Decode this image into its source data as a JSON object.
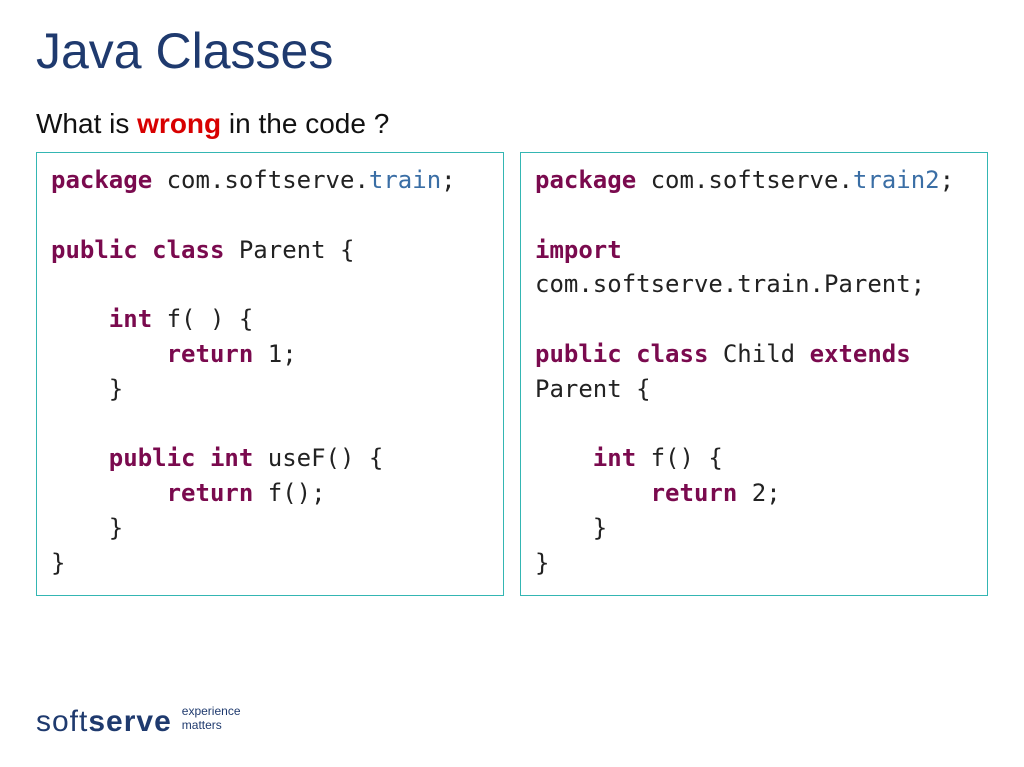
{
  "title": "Java Classes",
  "question": {
    "prefix": "What is ",
    "emph": "wrong",
    "suffix": " in the code ?"
  },
  "code_left": {
    "tokens": [
      {
        "c": "kw",
        "t": "package"
      },
      {
        "c": "plain",
        "t": " com.softserve."
      },
      {
        "c": "pk",
        "t": "train"
      },
      {
        "c": "plain",
        "t": ";"
      },
      {
        "c": "nl"
      },
      {
        "c": "nl"
      },
      {
        "c": "kw",
        "t": "public"
      },
      {
        "c": "plain",
        "t": " "
      },
      {
        "c": "kw",
        "t": "class"
      },
      {
        "c": "plain",
        "t": " Parent {"
      },
      {
        "c": "nl"
      },
      {
        "c": "nl"
      },
      {
        "c": "plain",
        "t": "    "
      },
      {
        "c": "kw",
        "t": "int"
      },
      {
        "c": "plain",
        "t": " f( ) {"
      },
      {
        "c": "nl"
      },
      {
        "c": "plain",
        "t": "        "
      },
      {
        "c": "kw",
        "t": "return"
      },
      {
        "c": "plain",
        "t": " 1;"
      },
      {
        "c": "nl"
      },
      {
        "c": "plain",
        "t": "    }"
      },
      {
        "c": "nl"
      },
      {
        "c": "nl"
      },
      {
        "c": "plain",
        "t": "    "
      },
      {
        "c": "kw",
        "t": "public"
      },
      {
        "c": "plain",
        "t": " "
      },
      {
        "c": "kw",
        "t": "int"
      },
      {
        "c": "plain",
        "t": " useF() {"
      },
      {
        "c": "nl"
      },
      {
        "c": "plain",
        "t": "        "
      },
      {
        "c": "kw",
        "t": "return"
      },
      {
        "c": "plain",
        "t": " f();"
      },
      {
        "c": "nl"
      },
      {
        "c": "plain",
        "t": "    }"
      },
      {
        "c": "nl"
      },
      {
        "c": "plain",
        "t": "}"
      }
    ]
  },
  "code_right": {
    "tokens": [
      {
        "c": "kw",
        "t": "package"
      },
      {
        "c": "plain",
        "t": " com.softserve."
      },
      {
        "c": "pk",
        "t": "train2"
      },
      {
        "c": "plain",
        "t": ";"
      },
      {
        "c": "nl"
      },
      {
        "c": "nl"
      },
      {
        "c": "kw",
        "t": "import"
      },
      {
        "c": "nl"
      },
      {
        "c": "plain",
        "t": "com.softserve.train.Parent;"
      },
      {
        "c": "nl"
      },
      {
        "c": "nl"
      },
      {
        "c": "kw",
        "t": "public"
      },
      {
        "c": "plain",
        "t": " "
      },
      {
        "c": "kw",
        "t": "class"
      },
      {
        "c": "plain",
        "t": " Child "
      },
      {
        "c": "kw",
        "t": "extends"
      },
      {
        "c": "nl"
      },
      {
        "c": "plain",
        "t": "Parent {"
      },
      {
        "c": "nl"
      },
      {
        "c": "nl"
      },
      {
        "c": "plain",
        "t": "    "
      },
      {
        "c": "kw",
        "t": "int"
      },
      {
        "c": "plain",
        "t": " f() {"
      },
      {
        "c": "nl"
      },
      {
        "c": "plain",
        "t": "        "
      },
      {
        "c": "kw",
        "t": "return"
      },
      {
        "c": "plain",
        "t": " 2;"
      },
      {
        "c": "nl"
      },
      {
        "c": "plain",
        "t": "    }"
      },
      {
        "c": "nl"
      },
      {
        "c": "plain",
        "t": "}"
      }
    ]
  },
  "footer": {
    "logo_soft": "soft",
    "logo_serve": "serve",
    "tag1": "experience",
    "tag2": "matters"
  }
}
